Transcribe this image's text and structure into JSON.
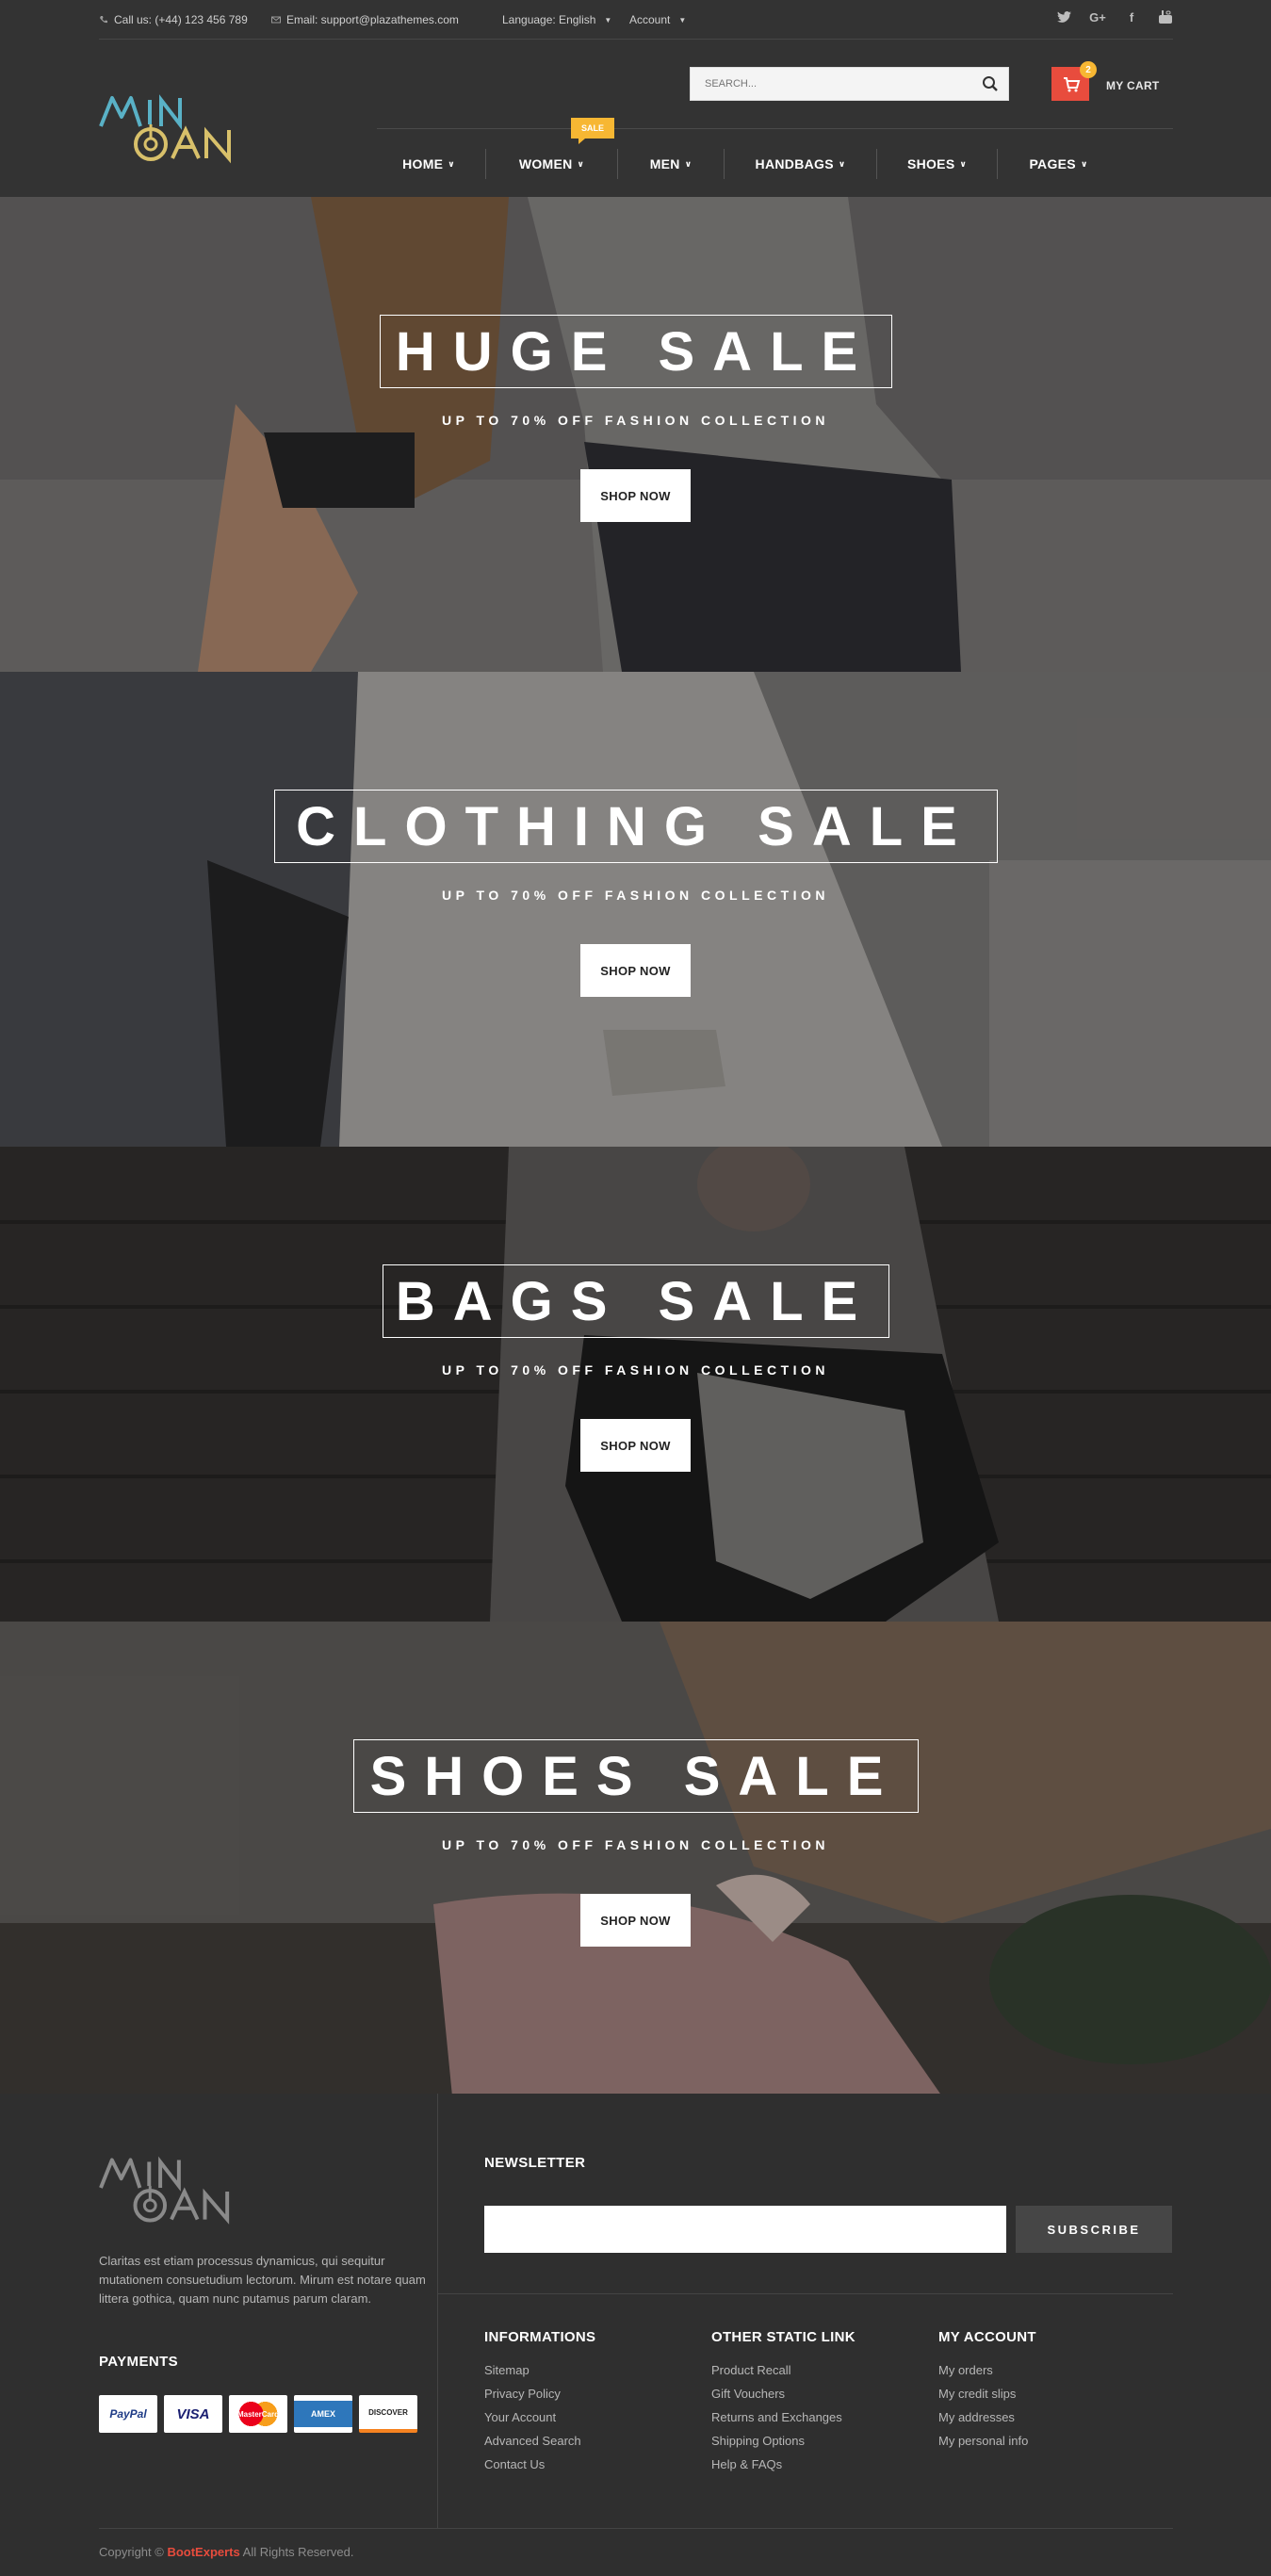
{
  "topbar": {
    "phone": "Call us: (+44) 123 456 789",
    "email": "Email: support@plazathemes.com",
    "language_label": "Language: English",
    "account_label": "Account"
  },
  "search": {
    "placeholder": "SEARCH..."
  },
  "cart": {
    "count": "2",
    "label": "MY CART"
  },
  "nav": {
    "sale_badge": "SALE",
    "items": [
      {
        "label": "HOME"
      },
      {
        "label": "WOMEN"
      },
      {
        "label": "MEN"
      },
      {
        "label": "HANDBAGS"
      },
      {
        "label": "SHOES"
      },
      {
        "label": "PAGES"
      }
    ]
  },
  "banners": [
    {
      "title": "HUGE SALE",
      "subtitle": "UP TO 70% OFF FASHION COLLECTION",
      "button": "SHOP NOW"
    },
    {
      "title": "CLOTHING SALE",
      "subtitle": "UP TO 70% OFF FASHION COLLECTION",
      "button": "SHOP NOW"
    },
    {
      "title": "BAGS SALE",
      "subtitle": "UP TO 70% OFF FASHION COLLECTION",
      "button": "SHOP NOW"
    },
    {
      "title": "SHOES SALE",
      "subtitle": "UP TO 70% OFF FASHION COLLECTION",
      "button": "SHOP NOW"
    }
  ],
  "footer": {
    "description": "Claritas est etiam processus dynamicus, qui sequitur mutationem consuetudium lectorum. Mirum est notare quam littera gothica, quam nunc putamus parum claram.",
    "payments_title": "PAYMENTS",
    "payments": [
      "PayPal",
      "VISA",
      "MasterCard",
      "AMEX",
      "DISCOVER"
    ],
    "newsletter_title": "NEWSLETTER",
    "subscribe_label": "SUBSCRIBE",
    "columns": [
      {
        "title": "INFORMATIONS",
        "links": [
          "Sitemap",
          "Privacy Policy",
          "Your Account",
          "Advanced Search",
          "Contact Us"
        ]
      },
      {
        "title": "OTHER STATIC LINK",
        "links": [
          "Product Recall",
          "Gift Vouchers",
          "Returns and Exchanges",
          "Shipping Options",
          "Help & FAQs"
        ]
      },
      {
        "title": "MY ACCOUNT",
        "links": [
          "My orders",
          "My credit slips",
          "My addresses",
          "My personal info"
        ]
      }
    ],
    "copyright_prefix": "Copyright ©",
    "copyright_brand": "BootExperts",
    "copyright_suffix": "All Rights Reserved."
  },
  "colors": {
    "accent": "#e84c3d",
    "badge": "#f7b733",
    "header_bg": "#333333",
    "footer_bg": "#2f2f2f"
  }
}
